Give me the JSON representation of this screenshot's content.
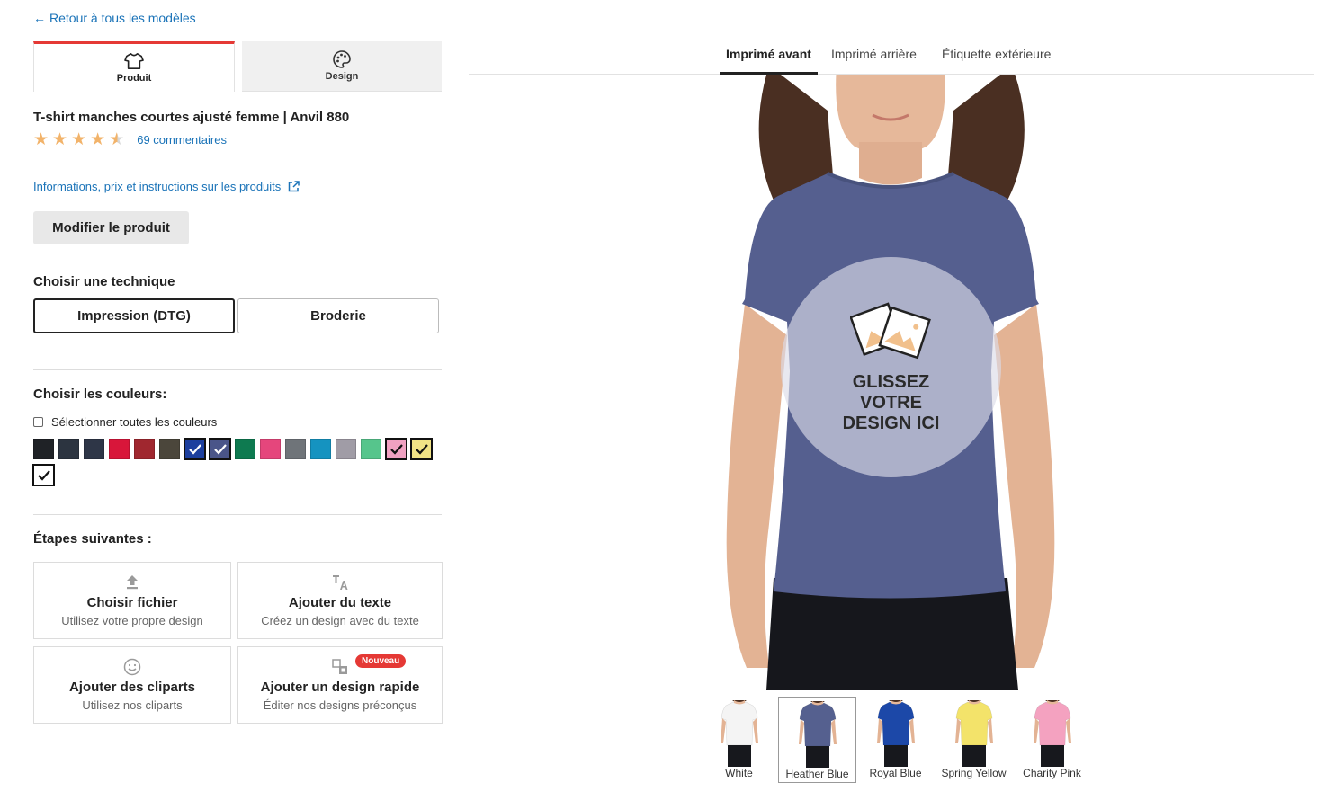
{
  "back_link": {
    "arrow": "←",
    "label": "Retour à tous les modèles"
  },
  "mode_tabs": [
    {
      "label": "Produit",
      "icon": "tshirt-icon",
      "active": true
    },
    {
      "label": "Design",
      "icon": "palette-icon",
      "active": false
    }
  ],
  "product": {
    "title": "T-shirt manches courtes ajusté femme | Anvil 880",
    "rating": 4.5,
    "reviews_label": "69 commentaires",
    "info_link": "Informations, prix et instructions sur les produits",
    "modify_button": "Modifier le produit"
  },
  "technique": {
    "title": "Choisir une technique",
    "options": [
      "Impression (DTG)",
      "Broderie"
    ],
    "selected": "Impression (DTG)"
  },
  "colors": {
    "title": "Choisir les couleurs:",
    "select_all_label": "Sélectionner toutes les couleurs",
    "swatches": [
      {
        "hex": "#1f2226",
        "checked": false
      },
      {
        "hex": "#2c3440",
        "checked": false
      },
      {
        "hex": "#2e3647",
        "checked": false
      },
      {
        "hex": "#d8163a",
        "checked": false
      },
      {
        "hex": "#a0272f",
        "checked": false
      },
      {
        "hex": "#4b463b",
        "checked": false
      },
      {
        "hex": "#1c3f9e",
        "checked": true
      },
      {
        "hex": "#4a5589",
        "checked": true
      },
      {
        "hex": "#0e7a50",
        "checked": false
      },
      {
        "hex": "#e5467c",
        "checked": false
      },
      {
        "hex": "#6f7479",
        "checked": false
      },
      {
        "hex": "#1593c0",
        "checked": false
      },
      {
        "hex": "#a09ca6",
        "checked": false
      },
      {
        "hex": "#56c58c",
        "checked": false
      },
      {
        "hex": "#f0a1c1",
        "checked": true
      },
      {
        "hex": "#f1e386",
        "checked": true
      },
      {
        "hex": "#ffffff",
        "checked": true
      }
    ]
  },
  "steps": {
    "title": "Étapes suivantes :",
    "cards": [
      {
        "title": "Choisir fichier",
        "subtitle": "Utilisez votre propre design",
        "icon": "upload-icon",
        "badge": ""
      },
      {
        "title": "Ajouter du texte",
        "subtitle": "Créez un design avec du texte",
        "icon": "text-icon",
        "badge": ""
      },
      {
        "title": "Ajouter des cliparts",
        "subtitle": "Utilisez nos cliparts",
        "icon": "smiley-icon",
        "badge": ""
      },
      {
        "title": "Ajouter un design rapide",
        "subtitle": "Éditer nos designs préconçus",
        "icon": "quick-design-icon",
        "badge": "Nouveau"
      }
    ]
  },
  "view_tabs": [
    {
      "label": "Imprimé avant",
      "active": true
    },
    {
      "label": "Imprimé arrière",
      "active": false
    },
    {
      "label": "Étiquette extérieure",
      "active": false
    }
  ],
  "drop_zone": {
    "line1": "GLISSEZ",
    "line2": "VOTRE",
    "line3": "DESIGN ICI"
  },
  "preview_shirt_color": "#555f8f",
  "thumbnails": [
    {
      "label": "White",
      "color": "#f4f4f4",
      "selected": false
    },
    {
      "label": "Heather Blue",
      "color": "#55608f",
      "selected": true
    },
    {
      "label": "Royal Blue",
      "color": "#1c48a8",
      "selected": false
    },
    {
      "label": "Spring Yellow",
      "color": "#f3e36a",
      "selected": false
    },
    {
      "label": "Charity Pink",
      "color": "#f4a2c0",
      "selected": false
    }
  ]
}
